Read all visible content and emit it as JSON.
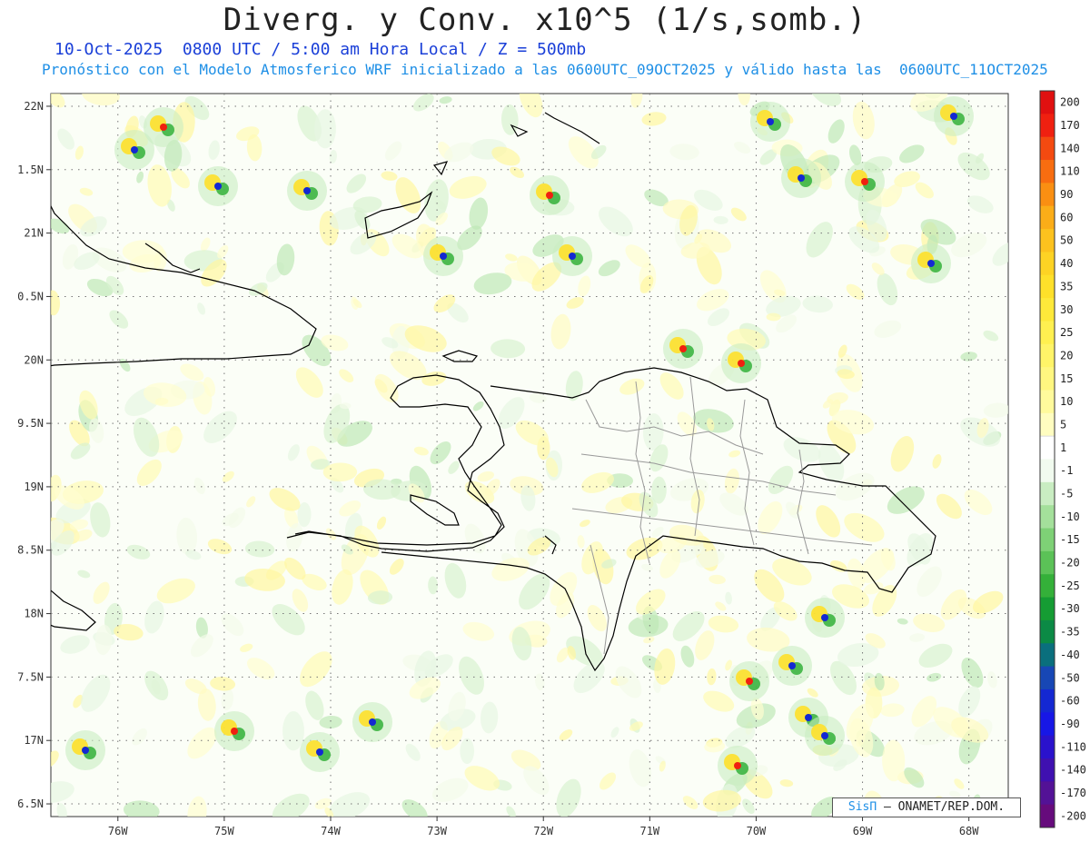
{
  "header": {
    "title": "Diverg. y Conv. x10^5 (1/s,somb.)",
    "subtitle": "10-Oct-2025  0800 UTC / 5:00 am Hora Local / Z = 500mb",
    "info": "Pronóstico con el Modelo Atmosferico WRF inicializado a las 0600UTC_09OCT2025 y válido hasta las  0600UTC_11OCT2025"
  },
  "map": {
    "lat_labels": [
      "22N",
      "1.5N",
      "21N",
      "0.5N",
      "20N",
      "9.5N",
      "19N",
      "8.5N",
      "18N",
      "7.5N",
      "17N",
      "6.5N"
    ],
    "lon_labels": [
      "76W",
      "75W",
      "74W",
      "73W",
      "72W",
      "71W",
      "70W",
      "69W",
      "68W"
    ],
    "lon_values": [
      -76,
      -75,
      -74,
      -73,
      -72,
      -71,
      -70,
      -69,
      -68
    ],
    "lat_values": [
      22,
      21.5,
      21,
      20.5,
      20,
      19.5,
      19,
      18.5,
      18,
      17.5,
      17,
      16.5
    ]
  },
  "colorbar": {
    "labels": [
      "200",
      "170",
      "140",
      "110",
      "90",
      "60",
      "50",
      "40",
      "35",
      "30",
      "25",
      "20",
      "15",
      "10",
      "5",
      "1",
      "-1",
      "-5",
      "-10",
      "-15",
      "-20",
      "-25",
      "-30",
      "-35",
      "-40",
      "-50",
      "-60",
      "-90",
      "-110",
      "-140",
      "-170",
      "-200"
    ],
    "colors": [
      "#e01010",
      "#f02010",
      "#f44a10",
      "#f86d10",
      "#fa8f12",
      "#fbad18",
      "#fcc21e",
      "#fdd324",
      "#fee02a",
      "#fee93a",
      "#fff050",
      "#fff468",
      "#fff780",
      "#fffa9c",
      "#fffdc0",
      "#ffffff",
      "#f1fbef",
      "#c9edc2",
      "#a4e09b",
      "#7ed176",
      "#5bc257",
      "#34b039",
      "#159c33",
      "#0b8a45",
      "#0a6f7d",
      "#1747b5",
      "#1428d2",
      "#1717e6",
      "#2a12cc",
      "#3f10b0",
      "#531296",
      "#660b7c"
    ]
  },
  "credit": {
    "brand": "SisΠ",
    "text": "– ONAMET/REP.DOM."
  }
}
